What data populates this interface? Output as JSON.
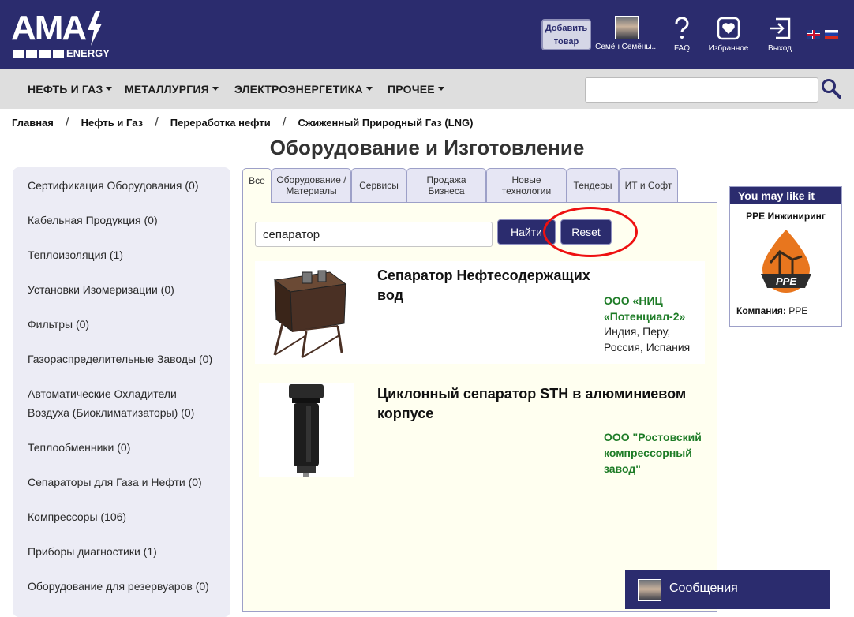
{
  "header": {
    "logo_text": "AMA",
    "logo_sub": "ENERGY",
    "add_product": "Добавить товар",
    "user_name": "Семён Семёны...",
    "faq": "FAQ",
    "favorites": "Избранное",
    "logout": "Выход"
  },
  "nav": {
    "items": [
      "НЕФТЬ И ГАЗ",
      "МЕТАЛЛУРГИЯ",
      "ЭЛЕКТРОЭНЕРГЕТИКА",
      "ПРОЧЕЕ"
    ],
    "search_value": ""
  },
  "breadcrumb": [
    "Главная",
    "Нефть и Газ",
    "Переработка нефти",
    "Сжиженный Природный Газ (LNG)"
  ],
  "page_title": "Оборудование и Изготовление",
  "sidebar": {
    "items": [
      "Сертификация Оборудования (0)",
      "Кабельная Продукция (0)",
      "Теплоизоляция (1)",
      "Установки Изомеризации (0)",
      "Фильтры (0)",
      "Газораспределительные Заводы (0)",
      "Автоматические Охладители Воздуха (Биоклиматизаторы) (0)",
      "Теплообменники (0)",
      "Сепараторы для Газа и Нефти (0)",
      "Компрессоры (106)",
      "Приборы диагностики (1)",
      "Оборудование для резервуаров (0)"
    ]
  },
  "tabs": [
    "Все",
    "Оборудование / Материалы",
    "Сервисы",
    "Продажа Бизнеса",
    "Новые технологии",
    "Тендеры",
    "ИТ и Софт"
  ],
  "search": {
    "value": "сепаратор",
    "find_label": "Найти",
    "reset_label": "Reset"
  },
  "results": [
    {
      "title": "Сепаратор Нефтесодержащих вод",
      "company": "ООО «НИЦ «Потенциал-2»",
      "location": "Индия, Перу, Россия, Испания"
    },
    {
      "title": "Циклонный сепаратор STH в алюминиевом корпусе",
      "company": "ООО \"Ростовский компрессорный завод\"",
      "location": ""
    }
  ],
  "widget": {
    "heading": "You may like it",
    "name": "PPE Инжиниринг",
    "logo_text": "PPE",
    "company_label": "Компания:",
    "company_value": "PPE"
  },
  "messages": {
    "label": "Сообщения"
  },
  "colors": {
    "brand": "#2b2c6e",
    "accent_green": "#1e7c27",
    "highlight_red": "#e11111"
  }
}
